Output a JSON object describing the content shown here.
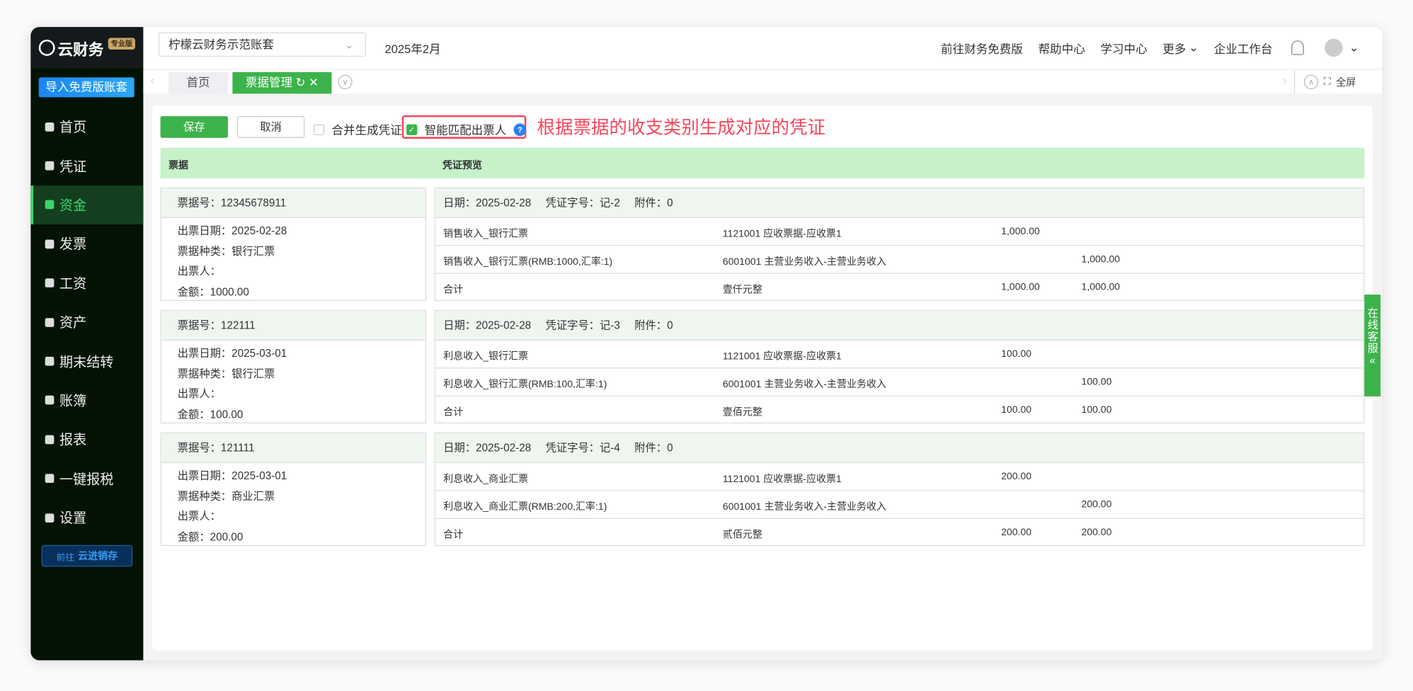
{
  "sidebar": {
    "logo": "云财务",
    "edition": "专业版",
    "import_btn": "导入免费版账套",
    "items": [
      {
        "label": "首页",
        "icon": "home-icon"
      },
      {
        "label": "凭证",
        "icon": "voucher-icon"
      },
      {
        "label": "资金",
        "icon": "money-icon",
        "active": true
      },
      {
        "label": "发票",
        "icon": "invoice-icon"
      },
      {
        "label": "工资",
        "icon": "salary-icon"
      },
      {
        "label": "资产",
        "icon": "asset-icon"
      },
      {
        "label": "期末结转",
        "icon": "percent-icon"
      },
      {
        "label": "账簿",
        "icon": "ledger-icon"
      },
      {
        "label": "报表",
        "icon": "report-icon"
      },
      {
        "label": "一键报税",
        "icon": "tax-icon"
      },
      {
        "label": "设置",
        "icon": "gear-icon"
      }
    ],
    "goto_prefix": "前往",
    "goto_label": "云进销存"
  },
  "header": {
    "account": "柠檬云财务示范账套",
    "period": "2025年2月",
    "links": [
      "前往财务免费版",
      "帮助中心",
      "学习中心",
      "更多",
      "企业工作台"
    ]
  },
  "tabs": {
    "items": [
      "首页",
      "票据管理"
    ],
    "fullscreen": "全屏"
  },
  "toolbar": {
    "save": "保存",
    "cancel": "取消",
    "merge": "合并生成凭证",
    "smart": "智能匹配出票人",
    "annotation": "根据票据的收支类别生成对应的凭证"
  },
  "table": {
    "col_bill": "票据",
    "col_voucher": "凭证预览",
    "groups": [
      {
        "bill_no": "票据号：12345678911",
        "fields": [
          "出票日期：2025-02-28",
          "票据种类：银行汇票",
          "出票人：",
          "金额：1000.00"
        ],
        "date": "日期：2025-02-28",
        "voucher_no": "凭证字号：记-2",
        "attach": "附件：0",
        "rows": [
          [
            "销售收入_银行汇票",
            "1121001 应收票据-应收票1",
            "1,000.00",
            ""
          ],
          [
            "销售收入_银行汇票(RMB:1000,汇率:1)",
            "6001001 主营业务收入-主营业务收入",
            "",
            "1,000.00"
          ],
          [
            "合计",
            "壹仟元整",
            "1,000.00",
            "1,000.00"
          ]
        ]
      },
      {
        "bill_no": "票据号：122111",
        "fields": [
          "出票日期：2025-03-01",
          "票据种类：银行汇票",
          "出票人：",
          "金额：100.00"
        ],
        "date": "日期：2025-02-28",
        "voucher_no": "凭证字号：记-3",
        "attach": "附件：0",
        "rows": [
          [
            "利息收入_银行汇票",
            "1121001 应收票据-应收票1",
            "100.00",
            ""
          ],
          [
            "利息收入_银行汇票(RMB:100,汇率:1)",
            "6001001 主营业务收入-主营业务收入",
            "",
            "100.00"
          ],
          [
            "合计",
            "壹佰元整",
            "100.00",
            "100.00"
          ]
        ]
      },
      {
        "bill_no": "票据号：121111",
        "fields": [
          "出票日期：2025-03-01",
          "票据种类：商业汇票",
          "出票人：",
          "金额：200.00"
        ],
        "date": "日期：2025-02-28",
        "voucher_no": "凭证字号：记-4",
        "attach": "附件：0",
        "rows": [
          [
            "利息收入_商业汇票",
            "1121001 应收票据-应收票1",
            "200.00",
            ""
          ],
          [
            "利息收入_商业汇票(RMB:200,汇率:1)",
            "6001001 主营业务收入-主营业务收入",
            "",
            "200.00"
          ],
          [
            "合计",
            "贰佰元整",
            "200.00",
            "200.00"
          ]
        ]
      }
    ]
  },
  "service": "在线客服"
}
